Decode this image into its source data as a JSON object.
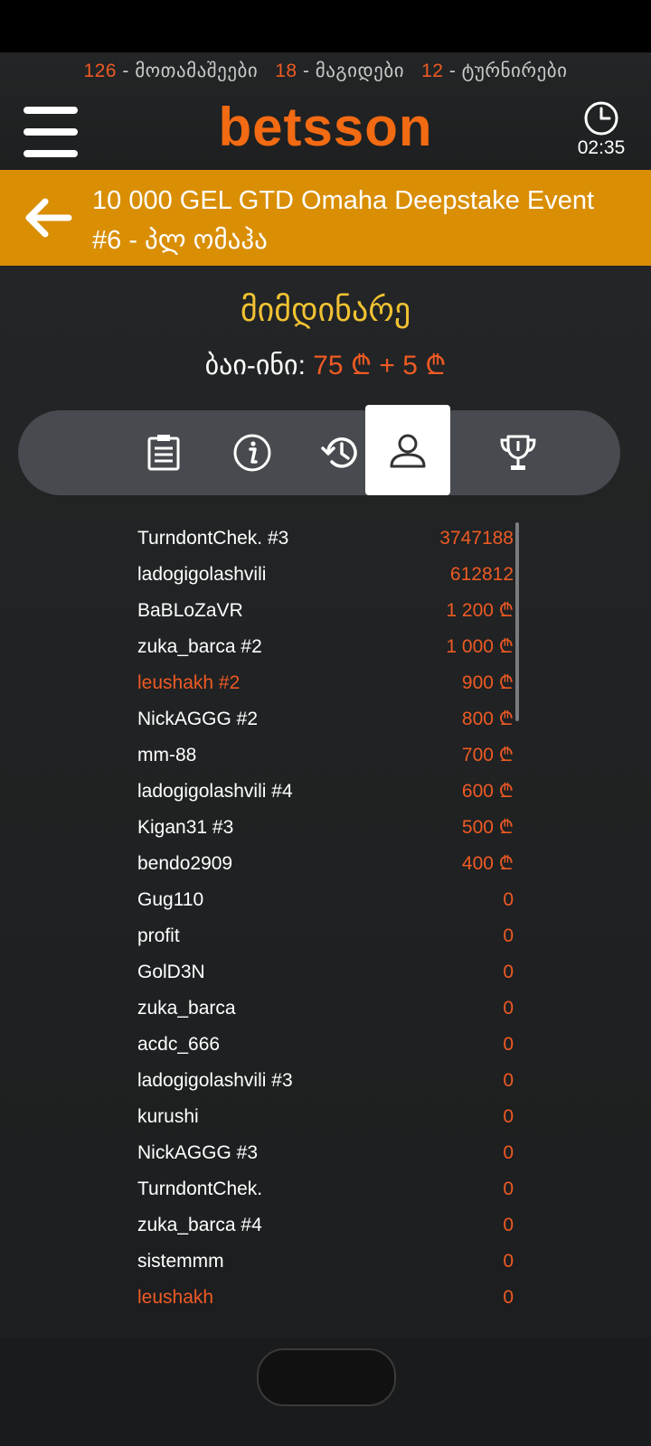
{
  "header": {
    "stats": {
      "players_count": "126",
      "players_label": "მოთამაშეები",
      "tables_count": "18",
      "tables_label": "მაგიდები",
      "tournaments_count": "12",
      "tournaments_label": "ტურნირები",
      "separator": "-"
    },
    "logo": "betsson",
    "clock_time": "02:35"
  },
  "tournament": {
    "title_line1": "10 000 GEL GTD Omaha Deepstake Event",
    "title_line2": "#6 - პლ ომაჰა",
    "status": "მიმდინარე",
    "buyin_label": "ბაი-ინი:",
    "buyin_amount": "75 ₾ + 5 ₾"
  },
  "tabs": [
    {
      "icon": "clipboard-icon",
      "active": false
    },
    {
      "icon": "info-icon",
      "active": false
    },
    {
      "icon": "history-icon",
      "active": false
    },
    {
      "icon": "user-icon",
      "active": true
    },
    {
      "icon": "trophy-icon",
      "active": false
    }
  ],
  "players": [
    {
      "name": "TurndontChek. #3",
      "prize": "3747188",
      "me": false
    },
    {
      "name": "ladogigolashvili",
      "prize": "612812",
      "me": false
    },
    {
      "name": "BaBLoZaVR",
      "prize": "1 200 ₾",
      "me": false
    },
    {
      "name": "zuka_barca #2",
      "prize": "1 000 ₾",
      "me": false
    },
    {
      "name": "leushakh #2",
      "prize": "900 ₾",
      "me": true
    },
    {
      "name": "NickAGGG #2",
      "prize": "800 ₾",
      "me": false
    },
    {
      "name": "mm-88",
      "prize": "700 ₾",
      "me": false
    },
    {
      "name": "ladogigolashvili #4",
      "prize": "600 ₾",
      "me": false
    },
    {
      "name": "Kigan31 #3",
      "prize": "500 ₾",
      "me": false
    },
    {
      "name": "bendo2909",
      "prize": "400 ₾",
      "me": false
    },
    {
      "name": "Gug110",
      "prize": "0",
      "me": false
    },
    {
      "name": "profit",
      "prize": "0",
      "me": false
    },
    {
      "name": "GolD3N",
      "prize": "0",
      "me": false
    },
    {
      "name": "zuka_barca",
      "prize": "0",
      "me": false
    },
    {
      "name": "acdc_666",
      "prize": "0",
      "me": false
    },
    {
      "name": "ladogigolashvili #3",
      "prize": "0",
      "me": false
    },
    {
      "name": "kurushi",
      "prize": "0",
      "me": false
    },
    {
      "name": "NickAGGG #3",
      "prize": "0",
      "me": false
    },
    {
      "name": "TurndontChek.",
      "prize": "0",
      "me": false
    },
    {
      "name": "zuka_barca #4",
      "prize": "0",
      "me": false
    },
    {
      "name": "sistemmm",
      "prize": "0",
      "me": false
    },
    {
      "name": "leushakh",
      "prize": "0",
      "me": true
    }
  ],
  "colors": {
    "accent": "#ee5a24",
    "brand": "#f26a12",
    "title_bar": "#d98e04",
    "status": "#f1c232"
  }
}
